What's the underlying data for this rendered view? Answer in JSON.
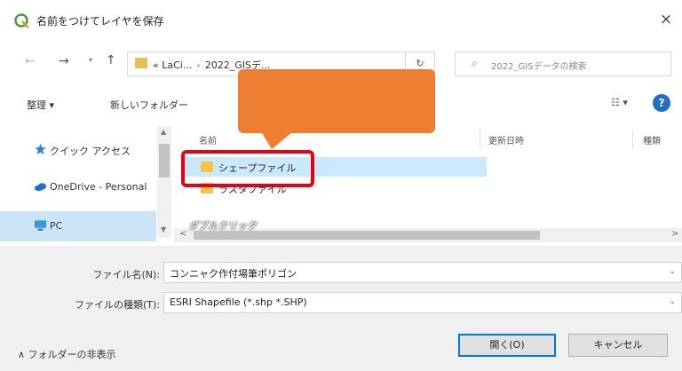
{
  "window": {
    "title": "名前をつけてレイヤを保存",
    "close_glyph": "×"
  },
  "address": {
    "back_glyph": "←",
    "forward_glyph": "→",
    "dropdown_glyph": "▾",
    "up_glyph": "↑",
    "path_prefix": "«",
    "path_seg1": "LaCi...",
    "path_sep": "›",
    "path_seg2": "2022_GISデ...",
    "refresh_glyph": "↻",
    "search_placeholder": "2022_GISデータの検索"
  },
  "toolbar": {
    "organize": "整理 ▾",
    "new_folder": "新しいフォルダー",
    "view": "☷ ▾",
    "help": "?"
  },
  "sidebar": {
    "items": [
      {
        "label": "クイック アクセス",
        "icon": "star-icon"
      },
      {
        "label": "OneDrive - Personal",
        "icon": "cloud-icon"
      },
      {
        "label": "PC",
        "icon": "pc-icon"
      }
    ]
  },
  "filelist": {
    "columns": {
      "name": "名前",
      "date": "更新日時",
      "type": "種類"
    },
    "rows": [
      {
        "label": "シェープファイル",
        "icon": "folder-icon"
      },
      {
        "label": "ラスタファイル",
        "icon": "folder-icon"
      }
    ]
  },
  "annotation": {
    "label": "ダブルクリック",
    "callout_color": "#ed7d31",
    "highlight_color": "#e60012"
  },
  "scroll": {
    "up": "▲",
    "down": "▼",
    "left": "<",
    "right": ">"
  },
  "footer": {
    "filename_label": "ファイル名(N):",
    "filename_value": "コンニャク作付場筆ポリゴン",
    "filetype_label": "ファイルの種類(T):",
    "filetype_value": "ESRI Shapefile (*.shp *.SHP)",
    "dropdown_glyph": "⌄",
    "hide_folders": "∧ フォルダーの非表示",
    "open_button": "開く(O)",
    "cancel_button": "キャンセル"
  },
  "colors": {
    "accent": "#0078d7",
    "selection": "#cce8ff",
    "folder": "#f0c548"
  }
}
